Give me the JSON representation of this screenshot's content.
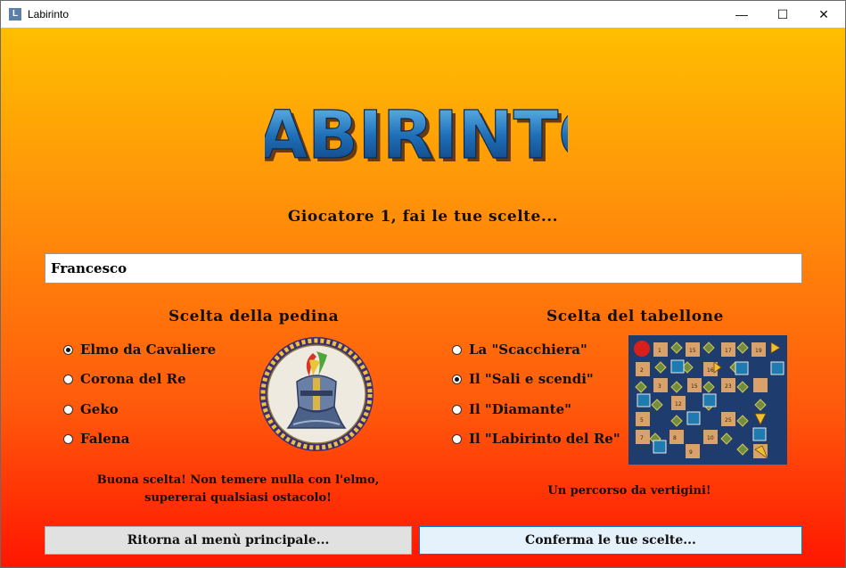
{
  "window": {
    "title": "Labirinto",
    "icon_letter": "L",
    "minimize": "—",
    "maximize": "☐",
    "close": "✕"
  },
  "logo": {
    "text": "LABIRINTO"
  },
  "prompt": "Giocatore 1, fai le tue scelte...",
  "player_name": {
    "value": "Francesco"
  },
  "pawn": {
    "title": "Scelta della pedina",
    "options": [
      "Elmo da Cavaliere",
      "Corona del Re",
      "Geko",
      "Falena"
    ],
    "selected": "Elmo da Cavaliere",
    "description_line1": "Buona scelta! Non temere nulla con l'elmo,",
    "description_line2": "supererai qualsiasi ostacolo!"
  },
  "board_choice": {
    "title": "Scelta del tabellone",
    "options": [
      "La \"Scacchiera\"",
      "Il \"Sali e scendi\"",
      "Il \"Diamante\"",
      "Il \"Labirinto del Re\""
    ],
    "selected": "Il \"Sali e scendi\"",
    "description": "Un percorso da vertigini!",
    "preview_numbers": [
      "1",
      "15",
      "17",
      "19",
      "2",
      "16",
      "3",
      "15",
      "23",
      "12",
      "5",
      "7",
      "25",
      "8",
      "9",
      "10"
    ]
  },
  "buttons": {
    "back": "Ritorna al menù principale...",
    "confirm": "Conferma le tue scelte..."
  },
  "colors": {
    "background_top": "#ffbe00",
    "background_bottom": "#ff1600",
    "logo_blue": "#1f6fb8",
    "board_bg": "#1e3c6e"
  }
}
